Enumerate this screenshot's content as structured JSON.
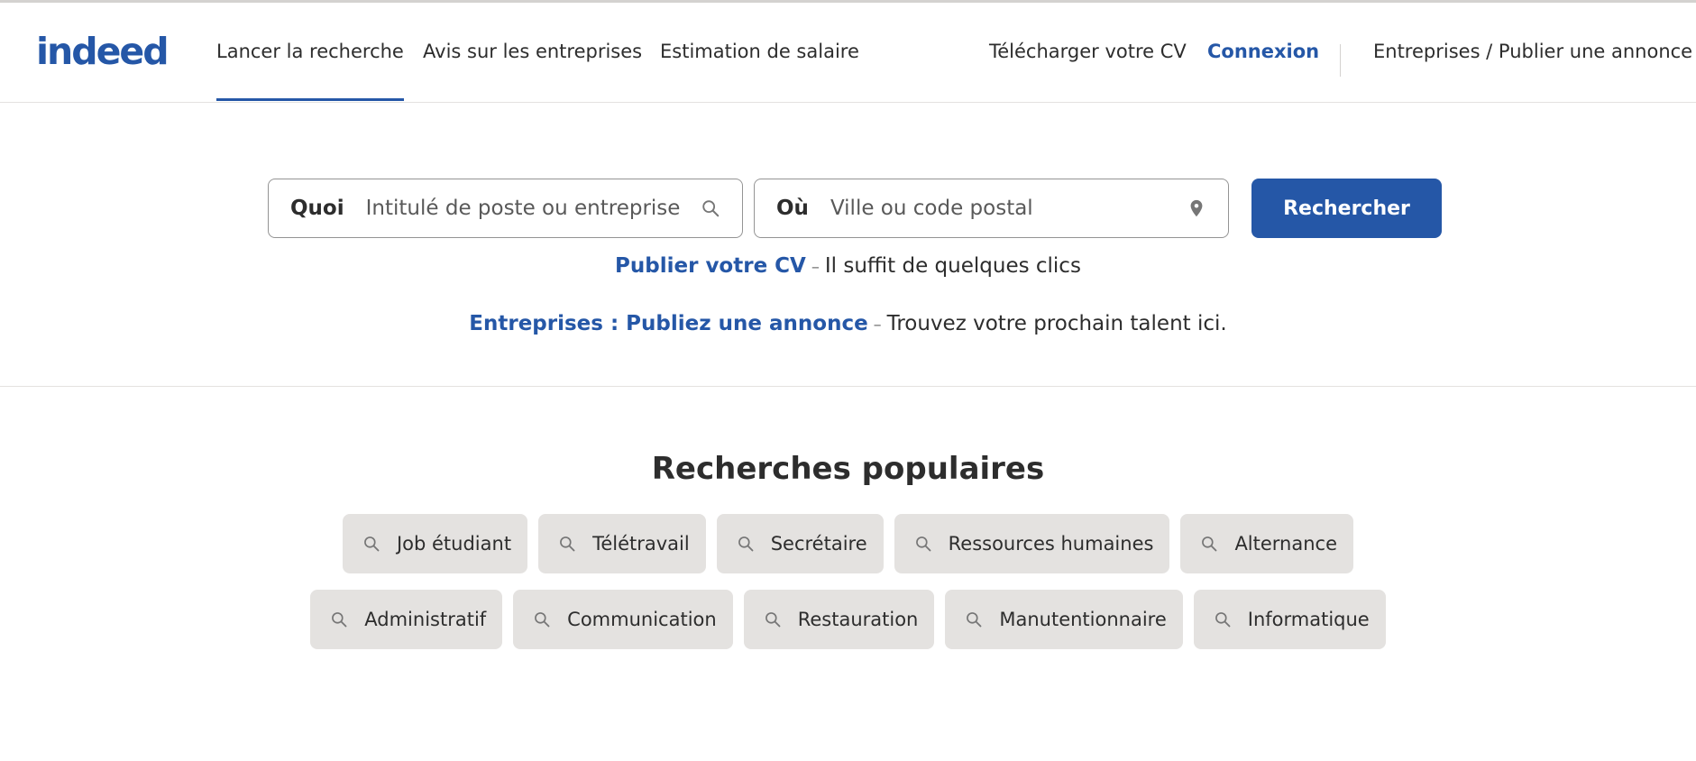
{
  "header": {
    "logo_text": "indeed",
    "nav": [
      {
        "label": "Lancer la recherche",
        "active": true
      },
      {
        "label": "Avis sur les entreprises",
        "active": false
      },
      {
        "label": "Estimation de salaire",
        "active": false
      }
    ],
    "upload_cv": "Télécharger votre CV",
    "login": "Connexion",
    "employers": "Entreprises / Publier une annonce"
  },
  "search": {
    "what_label": "Quoi",
    "what_placeholder": "Intitulé de poste ou entreprise",
    "what_icon": "search-icon",
    "where_label": "Où",
    "where_placeholder": "Ville ou code postal",
    "where_icon": "location-pin-icon",
    "button_label": "Rechercher"
  },
  "promos": {
    "cv_link": "Publier votre CV",
    "cv_separator": "–",
    "cv_text": "Il suffit de quelques clics",
    "employer_link": "Entreprises : Publiez une annonce",
    "employer_separator": "–",
    "employer_text": "Trouvez votre prochain talent ici."
  },
  "popular": {
    "title": "Recherches populaires",
    "row1": [
      "Job étudiant",
      "Télétravail",
      "Secrétaire",
      "Ressources humaines",
      "Alternance"
    ],
    "row2": [
      "Administratif",
      "Communication",
      "Restauration",
      "Manutentionnaire",
      "Informatique"
    ]
  },
  "colors": {
    "brand_blue": "#2557a7",
    "chip_bg": "#e4e2e0",
    "text": "#2d2d2d"
  }
}
